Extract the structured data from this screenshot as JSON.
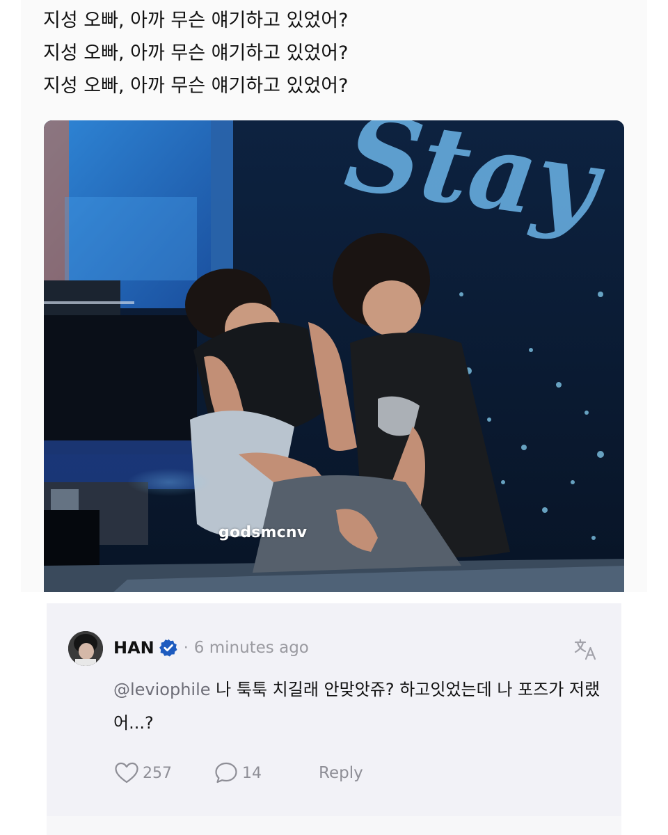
{
  "post": {
    "lines": [
      "지성 오빠, 아까 무슨 얘기하고 있었어?",
      "지성 오빠, 아까 무슨 얘기하고 있었어?",
      "지성 오빠, 아까 무슨 얘기하고 있었어?"
    ],
    "media": {
      "watermark": "godsmcnv",
      "backdrop_text": "Stay"
    }
  },
  "reply": {
    "username": "HAN",
    "verified": true,
    "separator": "·",
    "timestamp": "6 minutes ago",
    "mention": "@leviophile",
    "text": " 나 툭툭 치길래 안맞앗쥬? 하고잇었는데 나 포즈가 저랬어...?",
    "likes": "257",
    "comments": "14",
    "reply_label": "Reply",
    "icons": {
      "verified": "verified-badge-icon",
      "translate": "translate-icon",
      "like": "heart-icon",
      "comment": "comment-bubble-icon"
    }
  },
  "colors": {
    "verified_badge": "#1d5bbf",
    "meta_gray": "#9a9aa0",
    "card_background": "#f2f2f7"
  }
}
